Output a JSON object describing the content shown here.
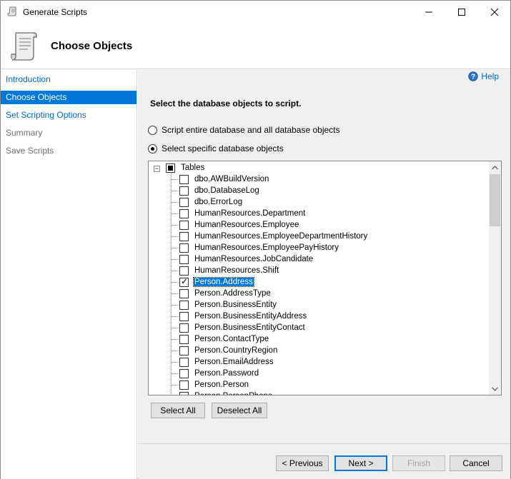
{
  "window": {
    "title": "Generate Scripts",
    "controls": {
      "minimize": "—",
      "maximize": "☐",
      "close": "✕"
    }
  },
  "header": {
    "title": "Choose Objects",
    "icon": "scroll-icon"
  },
  "nav": {
    "items": [
      {
        "label": "Introduction",
        "state": "link"
      },
      {
        "label": "Choose Objects",
        "state": "active"
      },
      {
        "label": "Set Scripting Options",
        "state": "link"
      },
      {
        "label": "Summary",
        "state": "disabled"
      },
      {
        "label": "Save Scripts",
        "state": "disabled"
      }
    ]
  },
  "main": {
    "help_label": "Help",
    "instruction": "Select the database objects to script.",
    "radio_entire": "Script entire database and all database objects",
    "radio_specific": "Select specific database objects",
    "tree": {
      "root_label": "Tables",
      "items": [
        {
          "label": "dbo.AWBuildVersion",
          "checked": false
        },
        {
          "label": "dbo.DatabaseLog",
          "checked": false
        },
        {
          "label": "dbo.ErrorLog",
          "checked": false
        },
        {
          "label": "HumanResources.Department",
          "checked": false
        },
        {
          "label": "HumanResources.Employee",
          "checked": false
        },
        {
          "label": "HumanResources.EmployeeDepartmentHistory",
          "checked": false
        },
        {
          "label": "HumanResources.EmployeePayHistory",
          "checked": false
        },
        {
          "label": "HumanResources.JobCandidate",
          "checked": false
        },
        {
          "label": "HumanResources.Shift",
          "checked": false
        },
        {
          "label": "Person.Address",
          "checked": true,
          "selected": true
        },
        {
          "label": "Person.AddressType",
          "checked": false
        },
        {
          "label": "Person.BusinessEntity",
          "checked": false
        },
        {
          "label": "Person.BusinessEntityAddress",
          "checked": false
        },
        {
          "label": "Person.BusinessEntityContact",
          "checked": false
        },
        {
          "label": "Person.ContactType",
          "checked": false
        },
        {
          "label": "Person.CountryRegion",
          "checked": false
        },
        {
          "label": "Person.EmailAddress",
          "checked": false
        },
        {
          "label": "Person.Password",
          "checked": false
        },
        {
          "label": "Person.Person",
          "checked": false
        },
        {
          "label": "Person.PersonPhone",
          "checked": false
        }
      ]
    },
    "select_all": "Select All",
    "deselect_all": "Deselect All"
  },
  "footer": {
    "previous": "< Previous",
    "next": "Next >",
    "finish": "Finish",
    "cancel": "Cancel"
  }
}
